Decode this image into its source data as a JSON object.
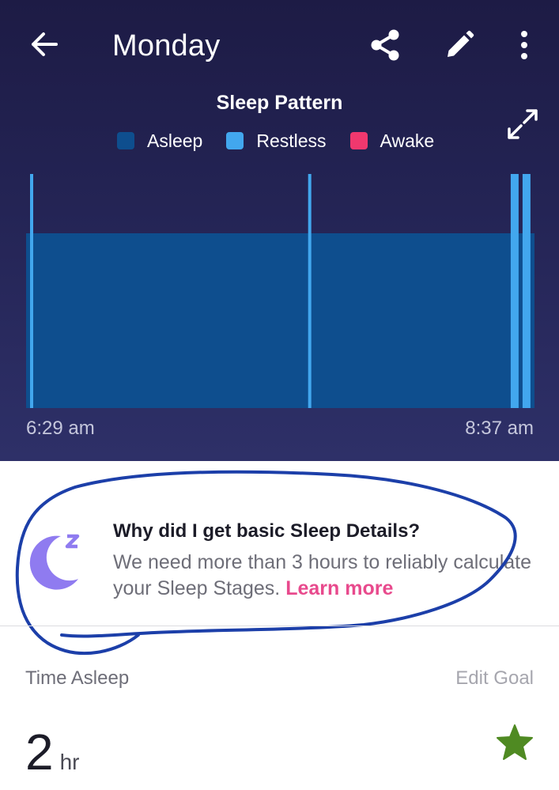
{
  "header": {
    "title": "Monday",
    "icons": {
      "back": "arrow-left-icon",
      "share": "share-icon",
      "edit": "pencil-icon",
      "more": "more-vertical-icon",
      "expand": "expand-icon"
    }
  },
  "chart_data": {
    "type": "bar",
    "title": "Sleep Pattern",
    "legend": [
      {
        "label": "Asleep",
        "color": "#0e4e8e"
      },
      {
        "label": "Restless",
        "color": "#42a7ee"
      },
      {
        "label": "Awake",
        "color": "#f0386e"
      }
    ],
    "legend_position": "top",
    "x_start_label": "6:29 am",
    "x_end_label": "8:37 am",
    "series": [
      {
        "name": "Asleep",
        "segments": [
          {
            "start": "6:29 am",
            "end": "8:37 am"
          }
        ]
      },
      {
        "name": "Restless",
        "segments": [
          {
            "start": "6:30 am",
            "end": "6:30 am"
          },
          {
            "start": "7:40 am",
            "end": "7:40 am"
          },
          {
            "start": "8:31 am",
            "end": "8:33 am"
          },
          {
            "start": "8:34 am",
            "end": "8:36 am"
          }
        ]
      },
      {
        "name": "Awake",
        "segments": []
      }
    ]
  },
  "info": {
    "title": "Why did I get basic Sleep Details?",
    "body": "We need more than 3 hours to reliably calculate your Sleep Stages.",
    "link": "Learn more",
    "icon": "moon-zzz-icon",
    "accent": "#e84a8d"
  },
  "stats": {
    "label": "Time Asleep",
    "edit_goal": "Edit Goal",
    "value": "2",
    "unit": "hr",
    "goal_icon": "star-icon",
    "goal_color": "#4f8a22"
  }
}
